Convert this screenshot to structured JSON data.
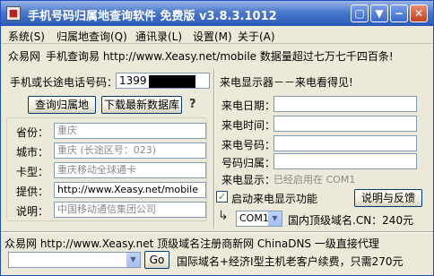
{
  "window": {
    "app_icon_glyph": "■",
    "title": "手机号码归属地查询软件 免费版 v3.8.3.1012",
    "controls": [
      "▢",
      "▼",
      "−",
      "✕"
    ]
  },
  "menu": [
    {
      "label": "系统(S)"
    },
    {
      "label": "归属地查询(Q)"
    },
    {
      "label": "通讯录(L)"
    },
    {
      "label": "设置(M)"
    },
    {
      "label": "关于(A)"
    }
  ],
  "banner": {
    "site_name": "众易网",
    "text": "手机查询易 http://www.Xeasy.net/mobile 数据量超过七万七千四百条!"
  },
  "lookup": {
    "label": "手机或长途电话号码：",
    "phone_value": "1399",
    "query_button": "查询归属地",
    "download_button": "下载最新数据库",
    "help_glyph": "?"
  },
  "info_fields": [
    {
      "label": "省份：",
      "value": "重庆"
    },
    {
      "label": "城市：",
      "value": "重庆 (长途区号：023)"
    },
    {
      "label": "卡型：",
      "value": "重庆移动全球通卡"
    },
    {
      "label": "提供：",
      "value": "http://www.Xeasy.net/mobile"
    },
    {
      "label": "说明：",
      "value": "中国移动通信集团公司"
    }
  ],
  "caller": {
    "title": "来电显示器－－来电看得见!",
    "fields": [
      {
        "label": "来电日期："
      },
      {
        "label": "来电时间："
      },
      {
        "label": "来电号码："
      },
      {
        "label": "号码归属："
      }
    ],
    "status_label": "来电显示：",
    "status_value": "已经启用在 COM1",
    "checkbox_label": "启动来电显示功能",
    "checkbox_checked": true,
    "checkbox_glyph": "✓",
    "feedback_button": "说明与反馈",
    "port_value": "COM1",
    "dropdown_glyph": "▼",
    "arrow_glyph": "↳",
    "domain_price": "国内顶级域名.CN：240元"
  },
  "footer": {
    "text": "众易网 http://www.Xeasy.net 顶级域名注册商新网 ChinaDNS 一级直接代理",
    "url_value": "",
    "go_button": "Go",
    "ad_text": "国际域名+经济Ⅰ型主机老客户续费，只需270元"
  },
  "colors": {
    "titlebar": "#2a58b8",
    "window_face": "#ece9d8",
    "field_border": "#7f9db9",
    "disabled_text": "#8a8a8a"
  }
}
